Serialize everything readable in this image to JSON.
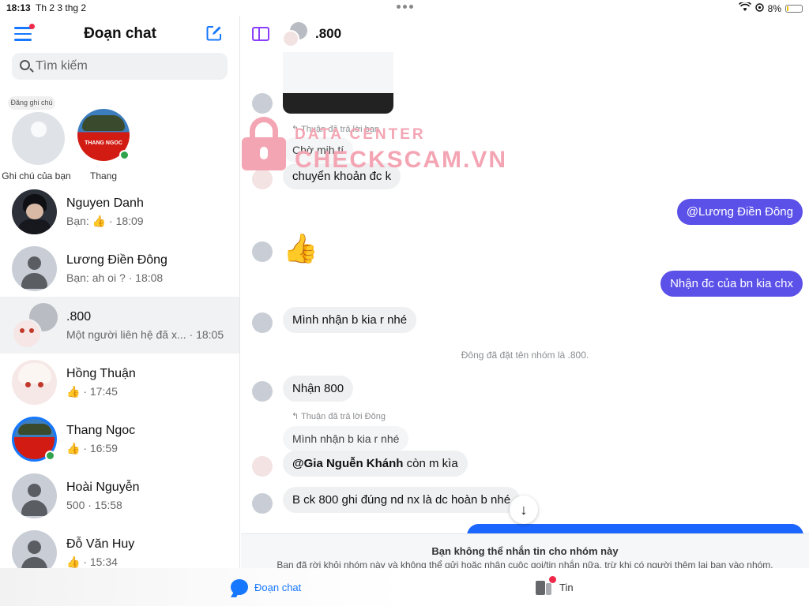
{
  "status_bar": {
    "time": "18:13",
    "date": "Th 2 3 thg 2",
    "battery": "8%"
  },
  "sidebar": {
    "title": "Đoạn chat",
    "search_placeholder": "Tìm kiếm",
    "stories": [
      {
        "note": "Đăng ghi chú",
        "label": "Ghi chú của bạn"
      },
      {
        "label": "Thang",
        "avatar_text": "THANG NGOC"
      }
    ],
    "conversations": [
      {
        "name": "Nguyen Danh",
        "preview": "Bạn: 👍 · 18:09"
      },
      {
        "name": "Lương Điền Đông",
        "preview": "Bạn: ah oi ? · 18:08"
      },
      {
        "name": ".800",
        "preview": "Một người liên hệ đã x... · 18:05"
      },
      {
        "name": "Hồng Thuận",
        "preview": "👍 · 17:45"
      },
      {
        "name": "Thang Ngoc",
        "preview": "👍 · 16:59"
      },
      {
        "name": "Hoài Nguyễn",
        "preview": "500 · 15:58"
      },
      {
        "name": "Đỗ Văn Huy",
        "preview": "👍 · 15:34"
      }
    ]
  },
  "chat": {
    "title": ".800",
    "messages": {
      "reply1_label": "Thuận đã trả lời bạn",
      "reply1_quote": "Chờ mih tí",
      "m1": "chuyển khoản đc k",
      "m2": "@Lương Điền Đông",
      "m3": "👍",
      "m4": "Nhận đc của bn kia chx",
      "m5": "Mình nhận b kia r nhé",
      "system": "Đông đã đặt tên nhóm là .800.",
      "m6": "Nhận 800",
      "reply2_label": "Thuận đã trả lời Đông",
      "reply2_quote": "Mình nhận b kia r nhé",
      "m7_mention": "@Gia Nguễn Khánh",
      "m7_rest": " còn m kìa",
      "m8": "B ck 800 ghi đúng nd nx là dc hoàn b nhé"
    },
    "scroll_down": "↓"
  },
  "watermark": {
    "line1": "DATA CENTER",
    "line2": "CHECKSCAM.VN"
  },
  "notice": {
    "title": "Bạn không thể nhắn tin cho nhóm này",
    "detail": "Bạn đã rời khỏi nhóm này và không thể gửi hoặc nhận cuộc gọi/tin nhắn nữa, trừ khi có người thêm lại bạn vào nhóm."
  },
  "tabs": {
    "chats": "Đoạn chat",
    "news": "Tin"
  },
  "colors": {
    "accent": "#1677ff",
    "my_bubble": "#5b51e8",
    "watermark": "#f4a5b3"
  }
}
